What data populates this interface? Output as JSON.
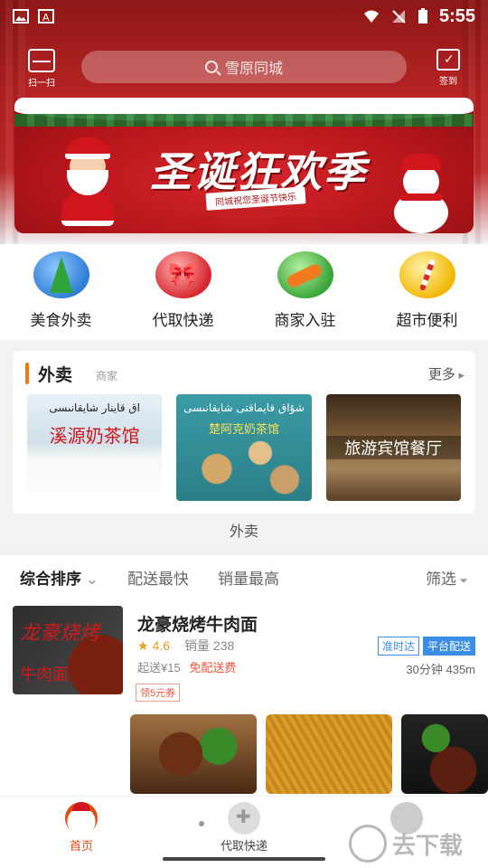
{
  "status_bar": {
    "time": "5:55"
  },
  "header": {
    "scan_label": "扫一扫",
    "search_placeholder": "雪原同城",
    "checkin_label": "签到"
  },
  "banner": {
    "title": "圣诞狂欢季",
    "subtitle": "同城祝您圣诞节快乐"
  },
  "quick_links": [
    {
      "label": "美食外卖",
      "icon": "christmas-tree-icon"
    },
    {
      "label": "代取快递",
      "icon": "gift-bow-icon"
    },
    {
      "label": "商家入驻",
      "icon": "candy-icon"
    },
    {
      "label": "超市便利",
      "icon": "candy-cane-icon"
    }
  ],
  "takeout": {
    "title": "外卖",
    "subtitle": "商家",
    "more": "更多",
    "shops": [
      {
        "uyghur": "اق قاينار شايقانىسى",
        "name": "溪源奶茶馆"
      },
      {
        "uyghur": "شۇاق قايماقتى شايقانىسى",
        "name": "楚阿克奶茶馆"
      },
      {
        "uyghur": "",
        "name": "旅游宾馆餐厅"
      }
    ],
    "footer": "外卖"
  },
  "sort_bar": {
    "options": [
      "综合排序",
      "配送最快",
      "销量最高"
    ],
    "filter": "筛选"
  },
  "shop_list": [
    {
      "image_text_1": "龙豪烧烤",
      "image_text_2": "牛肉面",
      "name": "龙豪烧烤牛肉面",
      "rating": "4.6",
      "sales": "销量 238",
      "badges": [
        "准时达",
        "平台配送"
      ],
      "min_order": "起送¥15",
      "delivery": "免配送费",
      "eta": "30分钟 435m",
      "coupon": "领5元券"
    }
  ],
  "bottom_nav": [
    {
      "label": "首页",
      "active": true
    },
    {
      "label": "代取快递",
      "active": false
    },
    {
      "label": "",
      "active": false
    }
  ],
  "watermark": "去下载",
  "colors": {
    "accent": "#e24a12",
    "brand_red": "#c32b2b",
    "badge_blue": "#3b8de6",
    "orange_bar": "#f07b14"
  }
}
